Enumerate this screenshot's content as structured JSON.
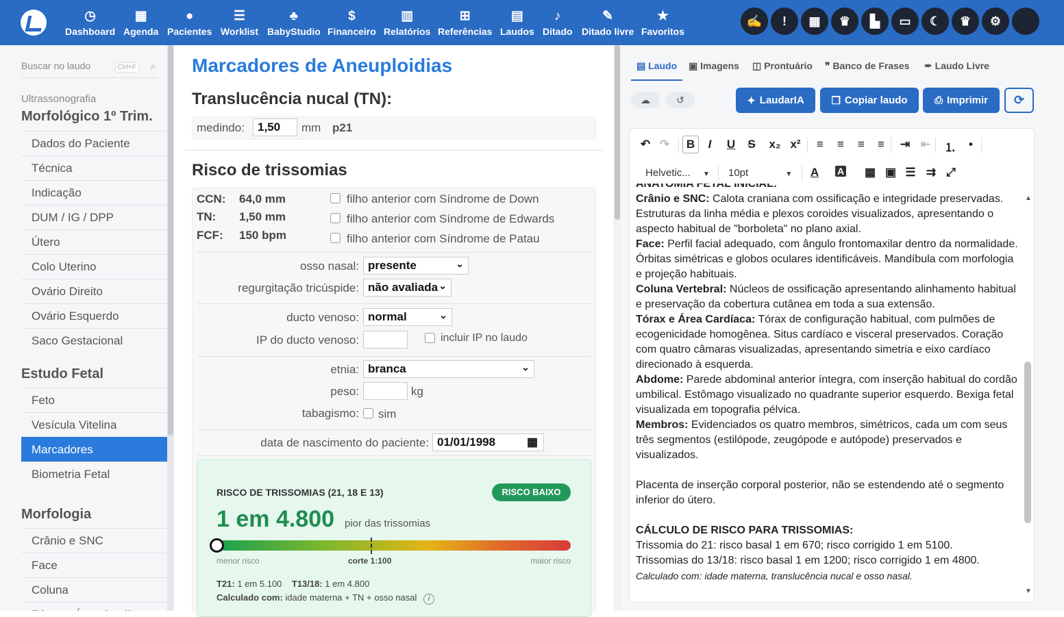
{
  "nav": {
    "items": [
      {
        "label": "Dashboard",
        "icon": "dashboard-icon",
        "glyph": "◷"
      },
      {
        "label": "Agenda",
        "icon": "calendar-icon",
        "glyph": "▦"
      },
      {
        "label": "Pacientes",
        "icon": "user-icon",
        "glyph": "●"
      },
      {
        "label": "Worklist",
        "icon": "checklist-icon",
        "glyph": "☰"
      },
      {
        "label": "BabyStudio",
        "icon": "baby-icon",
        "glyph": "♣"
      },
      {
        "label": "Financeiro",
        "icon": "dollar-icon",
        "glyph": "$"
      },
      {
        "label": "Relatórios",
        "icon": "chart-icon",
        "glyph": "▥"
      },
      {
        "label": "Referências",
        "icon": "plus-square-icon",
        "glyph": "⊞"
      },
      {
        "label": "Laudos",
        "icon": "file-icon",
        "glyph": "▤"
      },
      {
        "label": "Ditado",
        "icon": "microphone-icon",
        "glyph": "♪"
      },
      {
        "label": "Ditado livre",
        "icon": "feather-icon",
        "glyph": "✎"
      },
      {
        "label": "Favoritos",
        "icon": "star-icon",
        "glyph": "★"
      }
    ],
    "right_icons": [
      {
        "icon": "signature-icon",
        "glyph": "✍",
        "color": "#e24b4b"
      },
      {
        "icon": "alert-icon",
        "glyph": "!"
      },
      {
        "icon": "calendar-icon",
        "glyph": "▦"
      },
      {
        "icon": "crown-icon",
        "glyph": "♛"
      },
      {
        "icon": "building-icon",
        "glyph": "▙"
      },
      {
        "icon": "ticket-icon",
        "glyph": "▭"
      },
      {
        "icon": "moon-icon",
        "glyph": "☾"
      },
      {
        "icon": "crown-icon",
        "glyph": "♛"
      },
      {
        "icon": "gear-icon",
        "glyph": "⚙"
      },
      {
        "icon": "avatar",
        "glyph": ""
      }
    ]
  },
  "sidebar": {
    "search_placeholder": "Buscar no laudo",
    "search_shortcut": "Ctrl+F",
    "caption": "Ultrassonografia",
    "exam": "Morfológico 1º Trim.",
    "items": [
      "Dados do Paciente",
      "Técnica",
      "Indicação",
      "DUM / IG / DPP",
      "Útero",
      "Colo Uterino",
      "Ovário Direito",
      "Ovário Esquerdo",
      "Saco Gestacional"
    ],
    "section2": "Estudo Fetal",
    "items2": [
      "Feto",
      "Vesícula Vitelina",
      "Marcadores",
      "Biometria Fetal"
    ],
    "section3": "Morfologia",
    "items3": [
      "Crânio e SNC",
      "Face",
      "Coluna",
      "Tórax e Área Cardíaca"
    ]
  },
  "main": {
    "title": "Marcadores de Aneuploidias",
    "tn_title": "Translucência nucal (TN):",
    "tn_label": "medindo:",
    "tn_value": "1,50",
    "tn_unit": "mm",
    "tn_percentile": "p21",
    "risk_title": "Risco de trissomias",
    "ccn_label": "CCN:",
    "ccn_value": "64,0 mm",
    "tn2_label": "TN:",
    "tn2_value": "1,50 mm",
    "fcf_label": "FCF:",
    "fcf_value": "150 bpm",
    "check_down": "filho anterior com Síndrome de Down",
    "check_edwards": "filho anterior com Síndrome de Edwards",
    "check_patau": "filho anterior com Síndrome de Patau",
    "nasal_label": "osso nasal:",
    "nasal_value": "presente",
    "tric_label": "regurgitação tricúspide:",
    "tric_value": "não avaliada",
    "ducto_label": "ducto venoso:",
    "ducto_value": "normal",
    "ip_label": "IP do ducto venoso:",
    "ip_check": "incluir IP no laudo",
    "etnia_label": "etnia:",
    "etnia_value": "branca",
    "peso_label": "peso:",
    "peso_unit": "kg",
    "tabag_label": "tabagismo:",
    "tabag_check": "sim",
    "dob_label": "data de nascimento do paciente:",
    "dob_value": "01/01/1998",
    "card": {
      "title": "RISCO DE TRISSOMIAS (21, 18 E 13)",
      "badge": "RISCO BAIXO",
      "big": "1 em 4.800",
      "big_sub": "pior das trissomias",
      "risk_fraction": 0.0,
      "low": "menor risco",
      "cut": "corte 1:100",
      "high": "maior risco",
      "t21_label": "T21:",
      "t21_value": "1 em 5.100",
      "t1318_label": "T13/18:",
      "t1318_value": "1 em 4.800",
      "calc_label": "Calculado com:",
      "calc_value": "idade materna + TN + osso nasal"
    }
  },
  "right": {
    "tabs": [
      {
        "label": "Laudo",
        "icon": "file-icon",
        "glyph": "▤"
      },
      {
        "label": "Imagens",
        "icon": "image-icon",
        "glyph": "▣"
      },
      {
        "label": "Prontuário",
        "icon": "folder-icon",
        "glyph": "◫"
      },
      {
        "label": "Banco de Frases",
        "icon": "quote-icon",
        "glyph": "❞"
      },
      {
        "label": "Laudo Livre",
        "icon": "pen-icon",
        "glyph": "✒"
      }
    ],
    "btn_ia": "LaudarIA",
    "btn_copy": "Copiar laudo",
    "btn_print": "Imprimir",
    "font_name": "Helvetic...",
    "font_size": "10pt",
    "doc": [
      {
        "b": "ANATOMIA FETAL INICIAL:",
        "t": ""
      },
      {
        "b": "Crânio e SNC:",
        "t": " Calota craniana com ossificação e integridade preservadas. Estruturas da linha média e plexos coroides visualizados, apresentando o aspecto habitual de \"borboleta\" no plano axial."
      },
      {
        "b": "Face:",
        "t": " Perfil facial adequado, com ângulo frontomaxilar dentro da normalidade. Órbitas simétricas e globos oculares identificáveis. Mandíbula com morfologia e projeção habituais."
      },
      {
        "b": "Coluna Vertebral:",
        "t": " Núcleos de ossificação apresentando alinhamento habitual e preservação da cobertura cutânea em toda a sua extensão."
      },
      {
        "b": "Tórax e Área Cardíaca:",
        "t": " Tórax de configuração habitual, com pulmões de ecogenicidade homogênea. Situs cardíaco e visceral preservados. Coração com quatro câmaras visualizadas, apresentando simetria e eixo cardíaco direcionado à esquerda."
      },
      {
        "b": "Abdome:",
        "t": " Parede abdominal anterior íntegra, com inserção habitual do cordão umbilical. Estômago visualizado no quadrante superior esquerdo. Bexiga fetal visualizada em topografia pélvica."
      },
      {
        "b": "Membros:",
        "t": " Evidenciados os quatro membros, simétricos, cada um com seus três segmentos (estilópode, zeugópode e autópode) preservados e visualizados."
      }
    ],
    "placenta": "Placenta de inserção corporal posterior, não se estendendo até o segmento inferior do útero.",
    "calc_title": "CÁLCULO DE RISCO PARA TRISSOMIAS:",
    "calc_1": "Trissomia do 21: risco basal 1 em 670; risco corrigido 1 em 5100.",
    "calc_2": "Trissomias do 13/18: risco basal 1 em 1200; risco corrigido 1 em 4800.",
    "calc_3": "Calculado com: idade materna, translucência nucal e osso nasal."
  }
}
